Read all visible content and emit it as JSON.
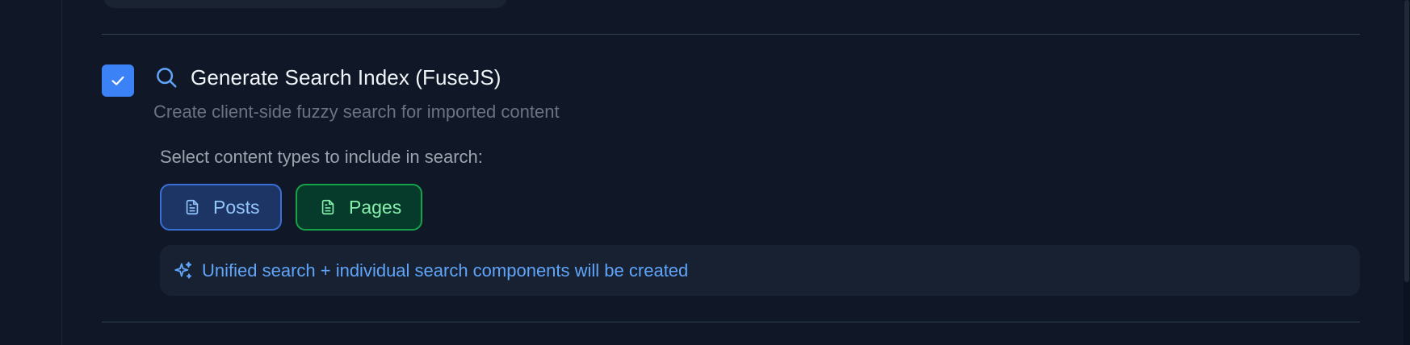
{
  "option": {
    "checked": true,
    "title": "Generate Search Index (FuseJS)",
    "description": "Create client-side fuzzy search for imported content",
    "title_icon": "search-icon"
  },
  "content_types": {
    "label": "Select content types to include in search:",
    "chips": [
      {
        "label": "Posts",
        "icon": "document-icon",
        "selected": true,
        "color": "#3b82f6"
      },
      {
        "label": "Pages",
        "icon": "document-icon",
        "selected": true,
        "color": "#22c55e"
      }
    ]
  },
  "info": {
    "icon": "sparkles-icon",
    "text": "Unified search + individual search components will be created"
  },
  "colors": {
    "background": "#101828",
    "accent": "#3b82f6",
    "success": "#22c55e"
  }
}
